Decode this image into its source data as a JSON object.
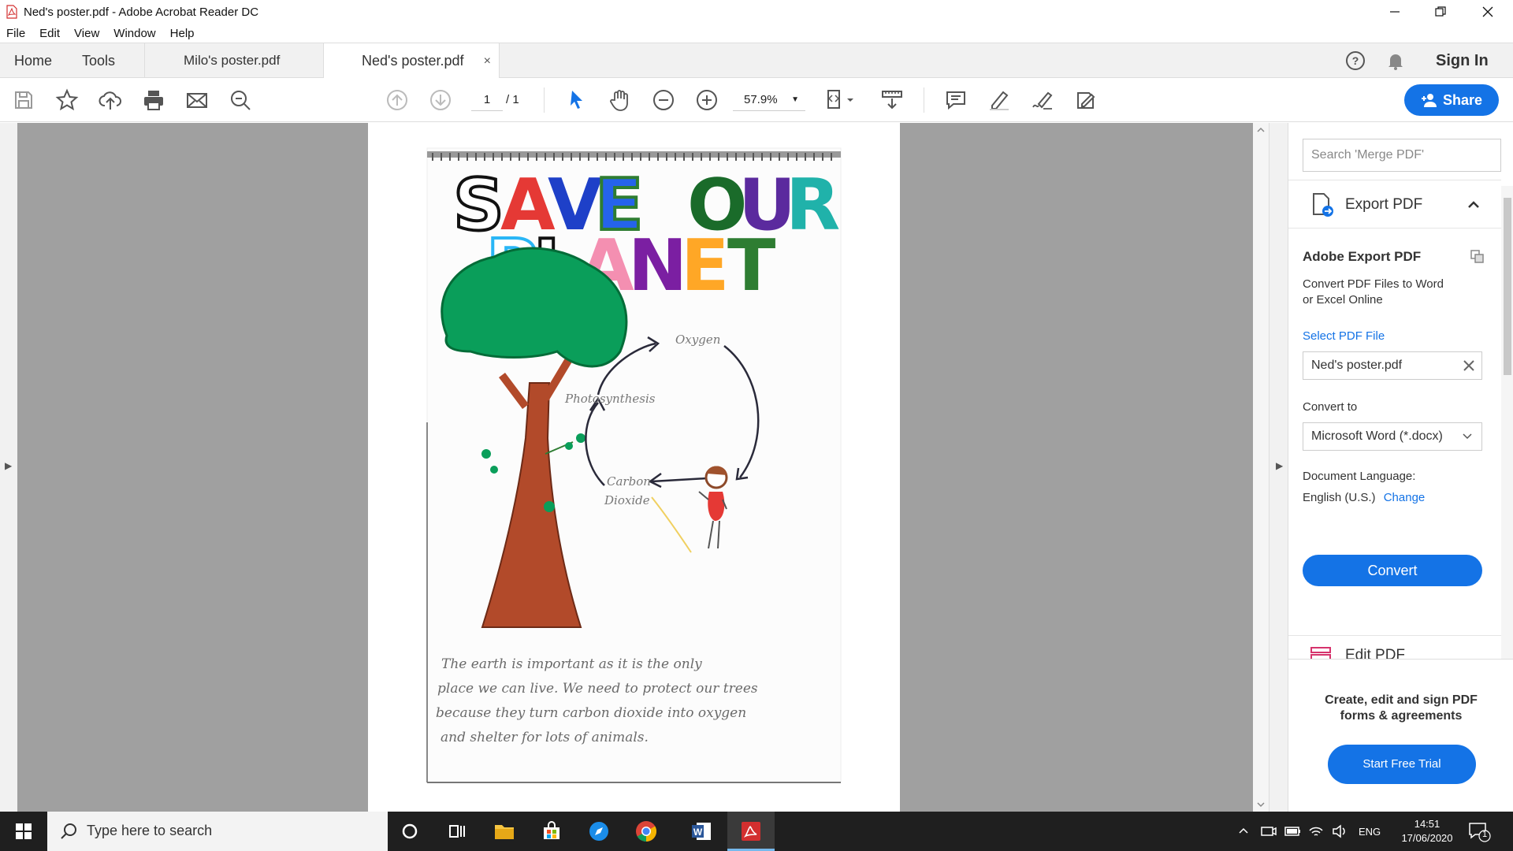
{
  "window": {
    "title": "Ned's poster.pdf - Adobe Acrobat Reader DC"
  },
  "menu": [
    "File",
    "Edit",
    "View",
    "Window",
    "Help"
  ],
  "tabs": {
    "home": "Home",
    "tools": "Tools",
    "doc1": "Milo's poster.pdf",
    "doc2": "Ned's poster.pdf",
    "close": "×"
  },
  "header": {
    "sign_in": "Sign In"
  },
  "toolbar": {
    "page_current": "1",
    "page_total": "/ 1",
    "zoom": "57.9%",
    "share": "Share"
  },
  "poster": {
    "title_line1": "SAVE OUR",
    "title_line2": "PLANET",
    "label_oxygen": "Oxygen",
    "label_photosynthesis": "Photosynthesis",
    "label_carbon": "Carbon",
    "label_dioxide": "Dioxide",
    "text_line1": "The earth is important as it is the only",
    "text_line2": "place we can live. We need to protect our trees",
    "text_line3": "because they turn carbon dioxide into oxygen",
    "text_line4": "and shelter for lots of animals."
  },
  "right_pane": {
    "search_placeholder": "Search 'Merge PDF'",
    "export_header": "Export PDF",
    "export_title": "Adobe Export PDF",
    "export_desc_line1": "Convert PDF Files to Word",
    "export_desc_line2": "or Excel Online",
    "select_file": "Select PDF File",
    "selected_file": "Ned's poster.pdf",
    "convert_to": "Convert to",
    "convert_format": "Microsoft Word (*.docx)",
    "doc_language_label": "Document Language:",
    "doc_language": "English (U.S.)",
    "change": "Change",
    "convert_button": "Convert",
    "edit_pdf": "Edit PDF",
    "promo_line1": "Create, edit and sign PDF",
    "promo_line2": "forms & agreements",
    "trial_button": "Start Free Trial"
  },
  "taskbar": {
    "search_placeholder": "Type here to search",
    "language": "ENG",
    "time": "14:51",
    "date": "17/06/2020",
    "notification_count": "1"
  },
  "colors": {
    "accent": "#1473e6",
    "taskbar": "#1f1f1f",
    "doc_bg": "#a0a0a0"
  }
}
